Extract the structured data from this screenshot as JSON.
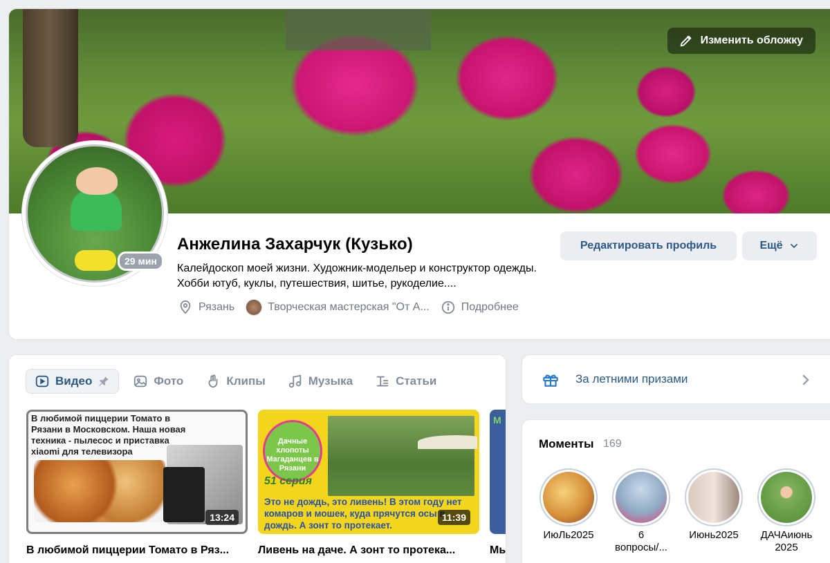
{
  "profile": {
    "cover_button": "Изменить обложку",
    "name": "Анжелина Захарчук (Кузько)",
    "status": "Калейдоскоп моей жизни. Художник-модельер и конструктор одежды. Хобби ютуб, куклы, путешествия, шитье, рукоделие....",
    "online_badge": "29 мин",
    "city": "Рязань",
    "community": "Творческая мастерская \"От А...",
    "details": "Подробнее",
    "edit_button": "Редактировать профиль",
    "more_button": "Ещё"
  },
  "tabs": [
    {
      "label": "Видео",
      "icon": "video-icon",
      "active": true
    },
    {
      "label": "Фото",
      "icon": "photo-icon"
    },
    {
      "label": "Клипы",
      "icon": "clips-icon"
    },
    {
      "label": "Музыка",
      "icon": "music-icon"
    },
    {
      "label": "Статьи",
      "icon": "articles-icon"
    }
  ],
  "videos": [
    {
      "thumb_text": "В любимой пиццерии Томато в Рязани в Московском. Наша новая техника - пылесос и приставка xiaomi для телевизора",
      "duration": "13:24",
      "title": "В любимой пиццерии Томато в Ряз..."
    },
    {
      "logo_text": "Дачные хлопоты Магаданцев в Рязани",
      "series": "51 серия",
      "caption": "Это не дождь, это ливень! В этом году нет комаров и мошек, куда прячутся осы в дождь. А зонт то протекает.",
      "duration": "11:39",
      "title": "Ливень на даче. А зонт то протека..."
    },
    {
      "thumb_text": "М",
      "title": "Мы"
    }
  ],
  "prize": {
    "label": "За летними призами"
  },
  "moments": {
    "title": "Моменты",
    "count": "169",
    "items": [
      {
        "label": "ИюЛь2025",
        "color": "#f0c060"
      },
      {
        "label": "6 вопросы/...",
        "color": "#d9e6f2"
      },
      {
        "label": "Июнь2025",
        "color": "#e6d8d0"
      },
      {
        "label": "ДАЧАиюнь 2025",
        "color": "#7fb05a"
      }
    ]
  },
  "colors": {
    "accent": "#2a5885",
    "muted": "#818c99",
    "background": "#edeef0"
  }
}
